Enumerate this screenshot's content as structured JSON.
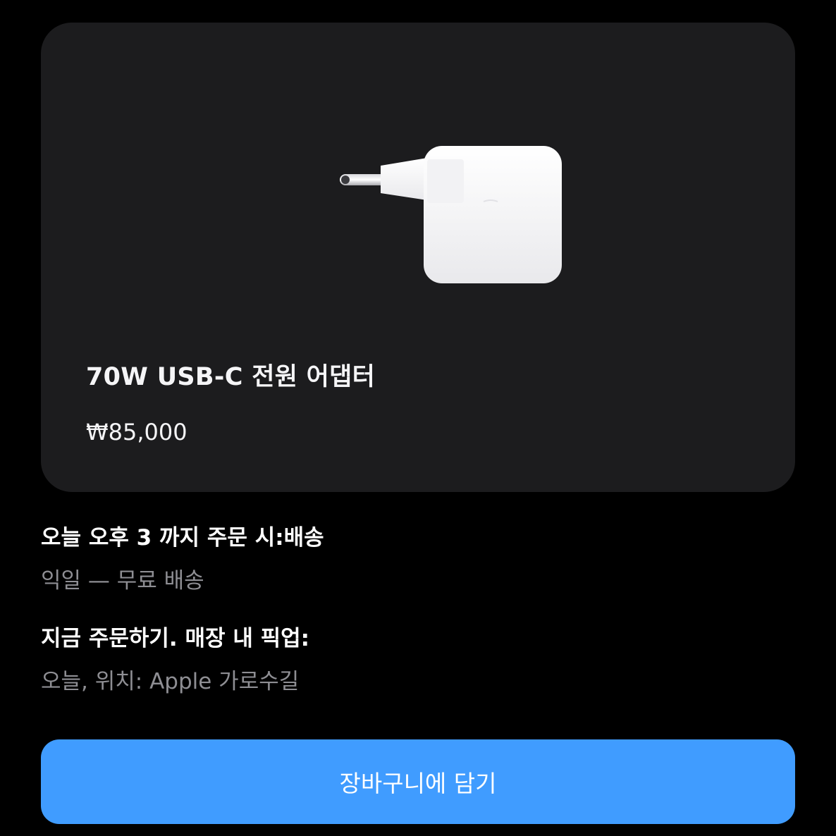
{
  "product": {
    "name": "70W USB-C 전원 어댑터",
    "price": "₩85,000",
    "image_icon": "usb-c-power-adapter-icon"
  },
  "delivery": {
    "heading": "오늘 오후 3 까지 주문 시:배송",
    "detail": "익일 — 무료 배송"
  },
  "pickup": {
    "heading": "지금 주문하기. 매장 내 픽업:",
    "detail": "오늘, 위치: Apple 가로수길"
  },
  "actions": {
    "add_to_bag_label": "장바구니에 담기"
  },
  "colors": {
    "background": "#000000",
    "card": "#1c1c1e",
    "accent_button": "#409cff",
    "secondary_text": "#8e8e93"
  }
}
